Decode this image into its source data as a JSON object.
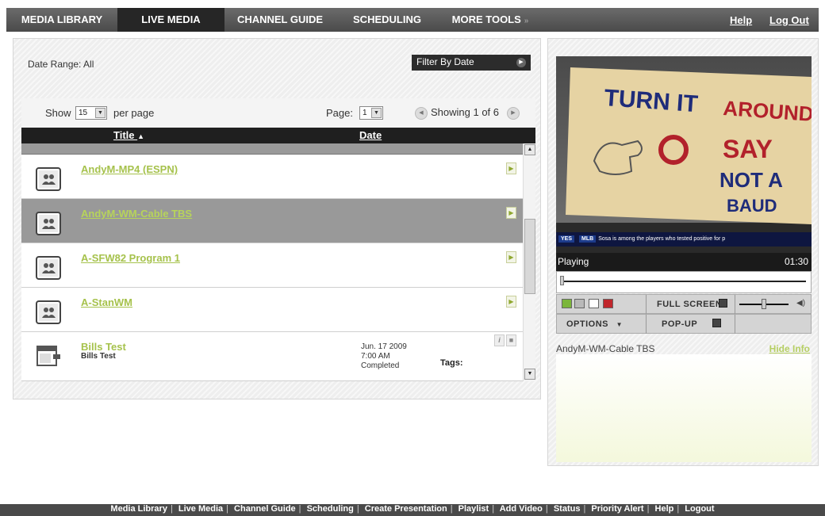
{
  "nav": {
    "items": [
      "MEDIA LIBRARY",
      "LIVE MEDIA",
      "CHANNEL GUIDE",
      "SCHEDULING",
      "MORE TOOLS"
    ],
    "active_item": "LIVE MEDIA",
    "help": "Help",
    "logout": "Log Out"
  },
  "filters": {
    "date_range_label": "Date Range: All",
    "filter_button": "Filter By Date"
  },
  "pager": {
    "show_label": "Show",
    "per_page_value": "15",
    "per_page_label": "per page",
    "page_label": "Page:",
    "page_value": "1",
    "showing": "Showing 1 of 6"
  },
  "table": {
    "columns": {
      "title": "Title",
      "date": "Date"
    },
    "rows": [
      {
        "title": "AndyM-MP4 (ESPN)",
        "subtitle": "",
        "selected": false
      },
      {
        "title": "AndyM-WM-Cable TBS",
        "subtitle": "",
        "selected": true
      },
      {
        "title": "A-SFW82 Program 1",
        "subtitle": "",
        "selected": false
      },
      {
        "title": "A-StanWM",
        "subtitle": "",
        "selected": false
      },
      {
        "title": "Bills Test",
        "subtitle": "Bills Test",
        "selected": false,
        "date_line1": "Jun. 17 2009",
        "date_line2": "7:00 AM",
        "status": "Completed",
        "tags_label": "Tags:"
      }
    ]
  },
  "player": {
    "ticker_badge1": "YES",
    "ticker_badge2": "MLB",
    "ticker_text": "Sosa is among the players who tested positive for p",
    "state": "Playing",
    "time": "01:30",
    "fullscreen_label": "FULL SCREEN",
    "options_label": "OPTIONS",
    "popup_label": "POP-UP",
    "now_playing_title": "AndyM-WM-Cable TBS",
    "hide_info": "Hide Info"
  },
  "footer": {
    "links": [
      "Media Library",
      "Live Media",
      "Channel Guide",
      "Scheduling",
      "Create Presentation",
      "Playlist",
      "Add Video",
      "Status",
      "Priority Alert",
      "Help",
      "Logout"
    ]
  },
  "colors": {
    "nav_bg": "#5c5c5c",
    "nav_active": "#262626",
    "title_link": "#a6c24c",
    "selected_row": "#999999"
  }
}
